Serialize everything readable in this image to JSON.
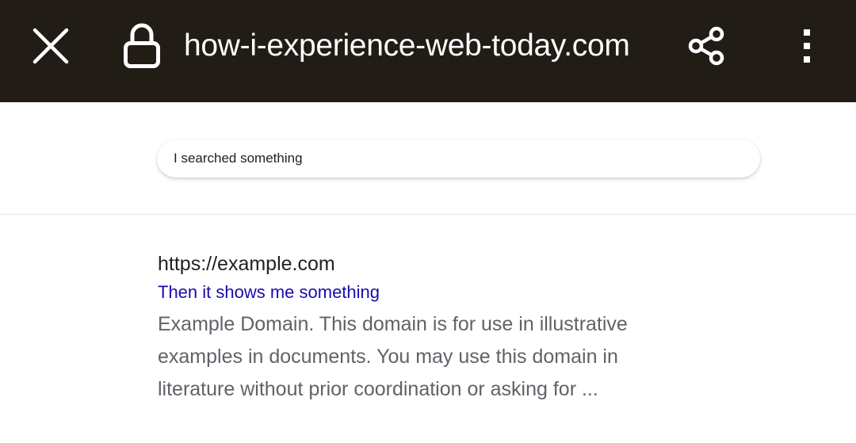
{
  "browser": {
    "url": "how-i-experience-web-today.com",
    "icons": {
      "close": "close-icon",
      "secure": "lock-icon",
      "share": "share-icon",
      "menu": "more-vert-icon"
    },
    "colors": {
      "toolbar_bg": "#221c17",
      "toolbar_fg": "#ffffff"
    }
  },
  "search": {
    "query": "I searched something"
  },
  "result": {
    "url": "https://example.com",
    "title": "Then it shows me something",
    "snippet_lines": [
      "Example Domain. This domain is for use in illustrative",
      "examples in documents. You may use this domain in",
      "literature without prior coordination or asking for ..."
    ],
    "colors": {
      "title": "#1a0dab",
      "snippet": "#5f6368"
    }
  }
}
